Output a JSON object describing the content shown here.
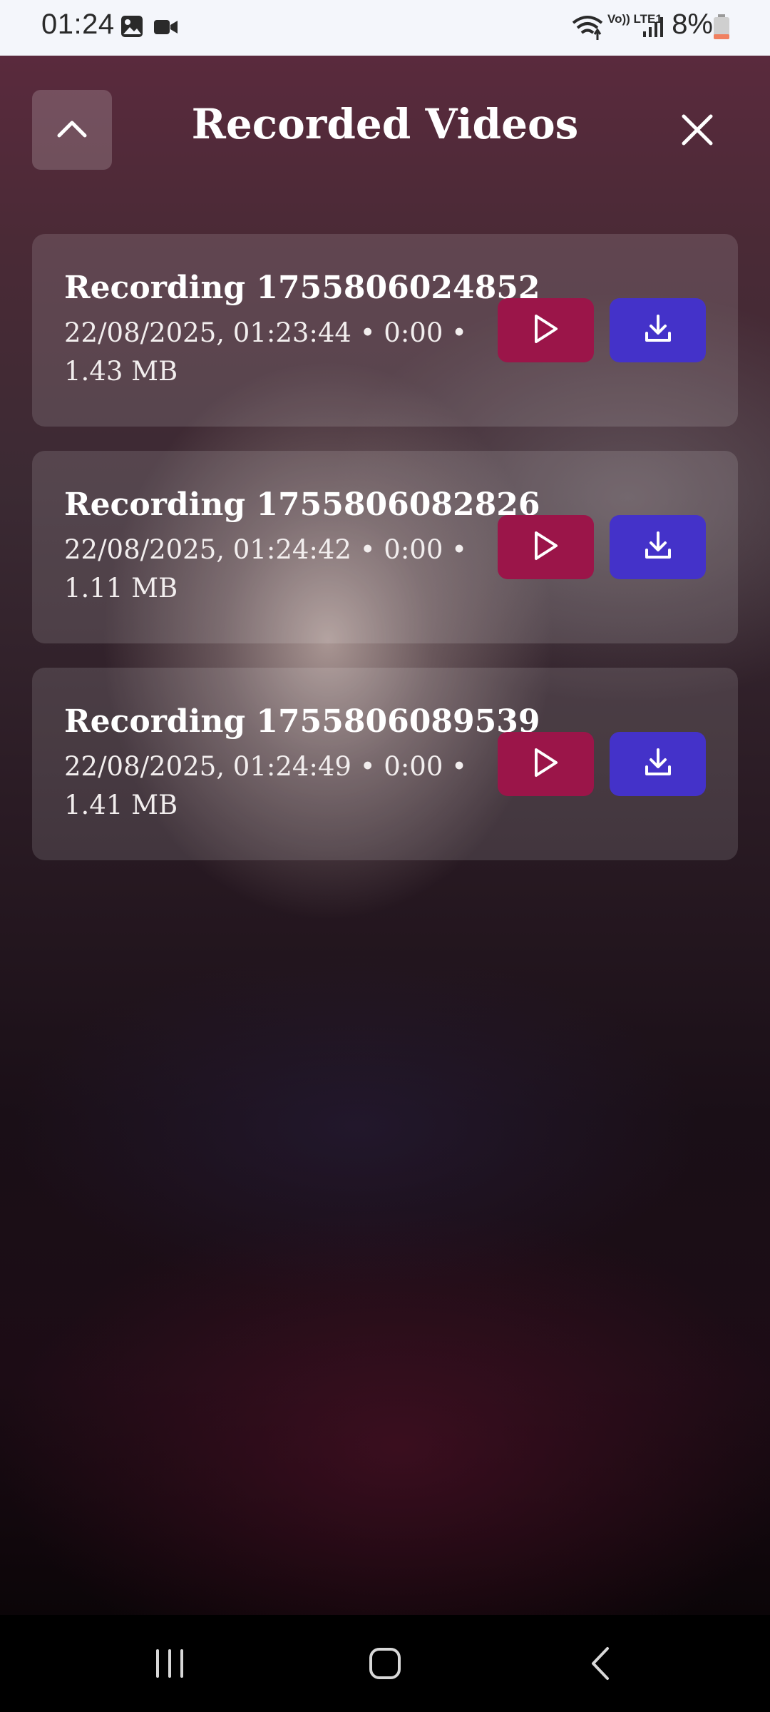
{
  "status_bar": {
    "time": "01:24",
    "network_label": "Vo)) LTE1",
    "battery_text": "8%",
    "icons": [
      "gallery-icon",
      "video-camera-icon",
      "wifi-icon",
      "volte-icon",
      "signal-icon",
      "battery-icon"
    ]
  },
  "header": {
    "title": "Recorded Videos",
    "collapse_icon": "chevron-up-icon",
    "close_icon": "close-icon"
  },
  "recordings": [
    {
      "title": "Recording 1755806024852",
      "meta": "22/08/2025, 01:23:44 • 0:00 • 1.43 MB"
    },
    {
      "title": "Recording 1755806082826",
      "meta": "22/08/2025, 01:24:42 • 0:00 • 1.11 MB"
    },
    {
      "title": "Recording 1755806089539",
      "meta": "22/08/2025, 01:24:49 • 0:00 • 1.41 MB"
    }
  ],
  "actions": {
    "play_icon": "play-icon",
    "download_icon": "download-icon"
  },
  "colors": {
    "play_button": "#9b1549",
    "download_button": "#4432c9",
    "status_bar_bg": "#f4f6fb",
    "nav_bar_bg": "#000000"
  },
  "nav_bar": {
    "icons": [
      "recent-apps-icon",
      "home-icon",
      "back-icon"
    ]
  }
}
